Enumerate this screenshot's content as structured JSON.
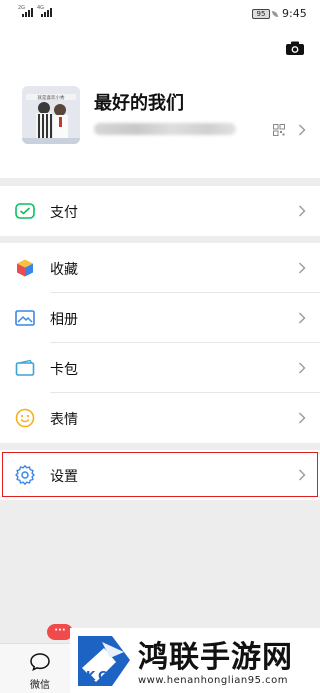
{
  "status_bar": {
    "sim1_tag": "2G",
    "sim2_tag": "4G",
    "battery": "95",
    "time": "9:45"
  },
  "header": {
    "camera_icon": "camera-icon",
    "avatar_caption": "就是喜欢小秀",
    "name": "最好的我们",
    "qr_icon": "qr-code-icon"
  },
  "menu": [
    {
      "label": "支付",
      "icon": "wallet-icon",
      "color": "#07c160"
    },
    {
      "label": "收藏",
      "icon": "cube-icon",
      "color": "#f0a830"
    },
    {
      "label": "相册",
      "icon": "photo-icon",
      "color": "#3a86e8"
    },
    {
      "label": "卡包",
      "icon": "card-icon",
      "color": "#3aa3d8"
    },
    {
      "label": "表情",
      "icon": "smiley-icon",
      "color": "#f5b21b"
    },
    {
      "label": "设置",
      "icon": "gear-icon",
      "color": "#3a86e8"
    }
  ],
  "tabbar": {
    "wechat_label": "微信",
    "badge": "···"
  },
  "watermark": {
    "title": "鸿联手游网",
    "url": "www.henanhonglian95.com"
  },
  "colors": {
    "highlight": "#e02020",
    "badge": "#f04a4a"
  }
}
